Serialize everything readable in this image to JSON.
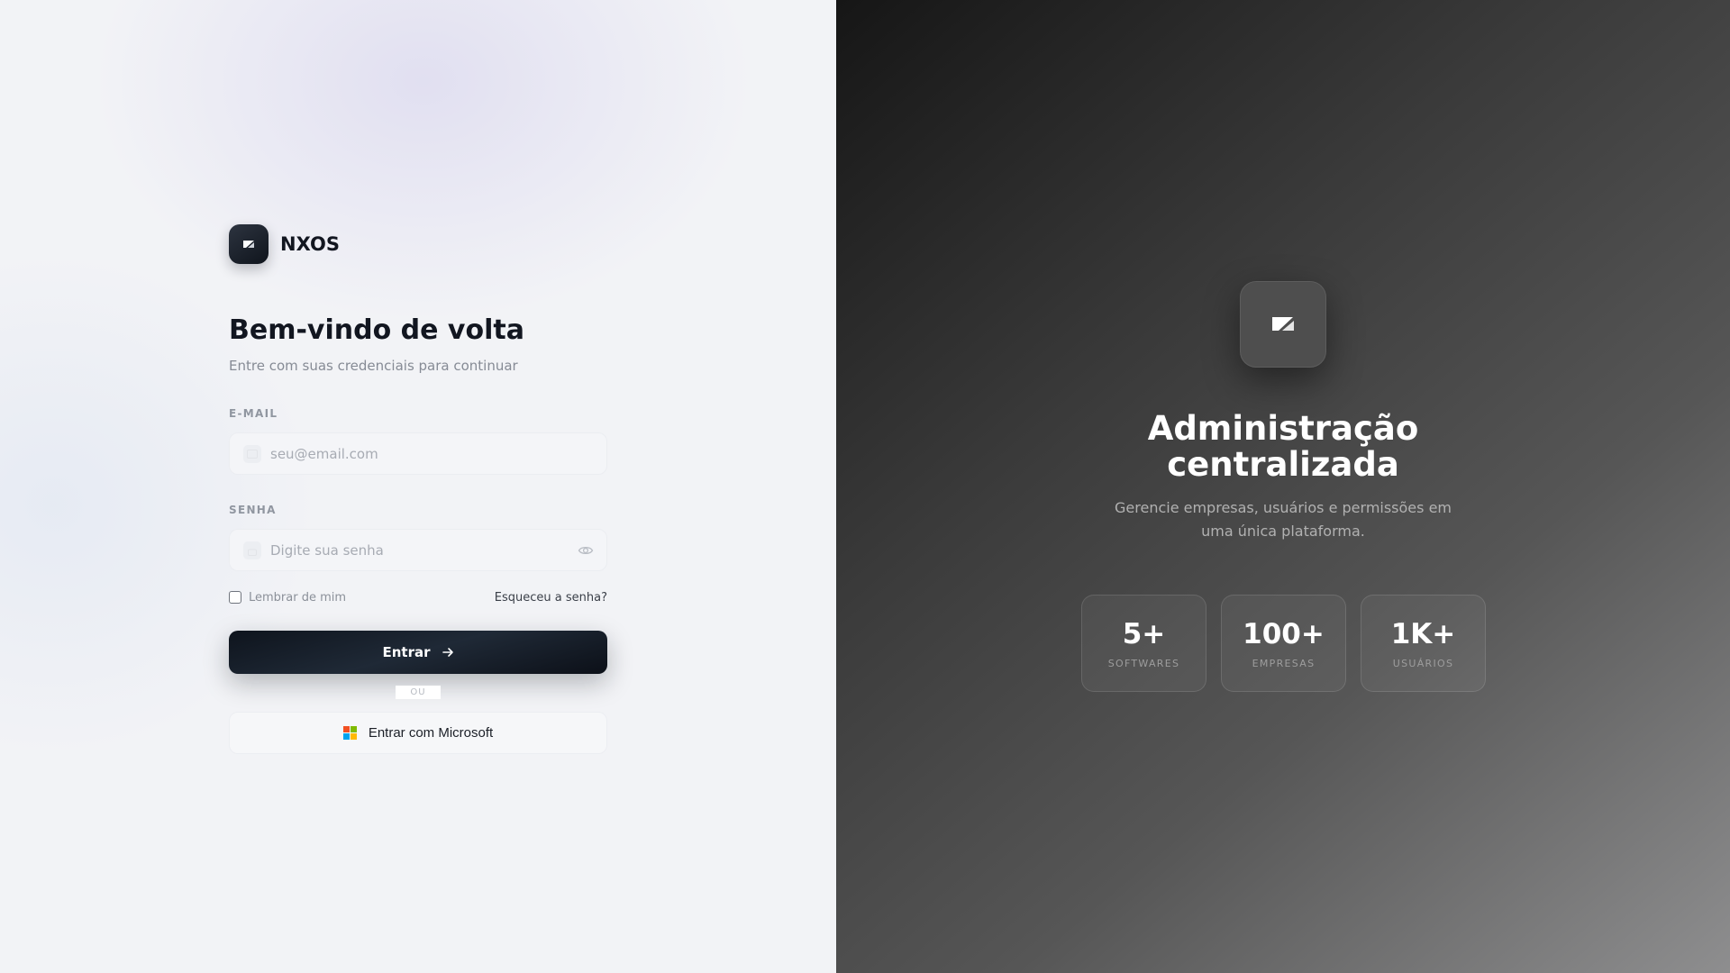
{
  "brand": {
    "name": "NXOS"
  },
  "login": {
    "title": "Bem-vindo de volta",
    "subtitle": "Entre com suas credenciais para continuar",
    "email_label": "E-MAIL",
    "email_placeholder": "seu@email.com",
    "email_value": "",
    "password_label": "SENHA",
    "password_placeholder": "Digite sua senha",
    "password_value": "",
    "remember_label": "Lembrar de mim",
    "remember_checked": false,
    "forgot_label": "Esqueceu a senha?",
    "submit_label": "Entrar",
    "divider_label": "OU",
    "microsoft_label": "Entrar com Microsoft"
  },
  "icons": {
    "brand": "logo-icon",
    "email_field": "mail-icon",
    "password_field": "lock-icon",
    "show_password": "eye-icon",
    "submit": "arrow-right-icon",
    "microsoft": "microsoft-logo-icon"
  },
  "hero": {
    "title_line1": "Administração",
    "title_line2": "centralizada",
    "description_line1": "Gerencie empresas, usuários e permissões em",
    "description_line2": "uma única plataforma.",
    "stats": [
      {
        "value": "5+",
        "label": "SOFTWARES"
      },
      {
        "value": "100+",
        "label": "EMPRESAS"
      },
      {
        "value": "1K+",
        "label": "USUÁRIOS"
      }
    ]
  },
  "colors": {
    "primary": "#121620",
    "left_bg": "#f2f3f6",
    "right_bg_dark": "#161616",
    "right_bg_light": "#8e8e8f",
    "microsoft": [
      "#f25022",
      "#7fba00",
      "#00a4ef",
      "#ffb900"
    ]
  }
}
